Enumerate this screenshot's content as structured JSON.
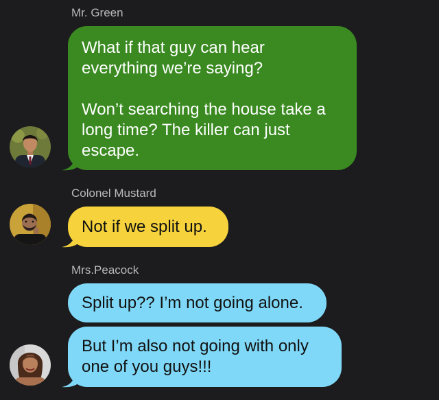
{
  "colors": {
    "background": "#1c1c1e",
    "green": "#3a8a21",
    "yellow": "#f6d33c",
    "blue": "#7fd8f7",
    "sender_name": "#b9b9bd"
  },
  "messages": [
    {
      "sender": "Mr. Green",
      "avatar_icon": "man-in-suit-avatar-icon",
      "bubbles": [
        {
          "paragraphs": [
            [
              "What if that guy can hear",
              "everything we’re saying?"
            ],
            [
              "Won’t searching the house take a",
              "long time? The killer can just",
              "escape."
            ]
          ]
        }
      ]
    },
    {
      "sender": "Colonel Mustard",
      "avatar_icon": "bearded-man-avatar-icon",
      "bubbles": [
        {
          "paragraphs": [
            [
              "Not if we split up."
            ]
          ]
        }
      ]
    },
    {
      "sender": "Mrs.Peacock",
      "avatar_icon": "woman-avatar-icon",
      "bubbles": [
        {
          "paragraphs": [
            [
              "Split up?? I’m not going alone."
            ]
          ]
        },
        {
          "paragraphs": [
            [
              "But I’m also not going with only",
              "one of you guys!!!"
            ]
          ]
        }
      ]
    }
  ]
}
